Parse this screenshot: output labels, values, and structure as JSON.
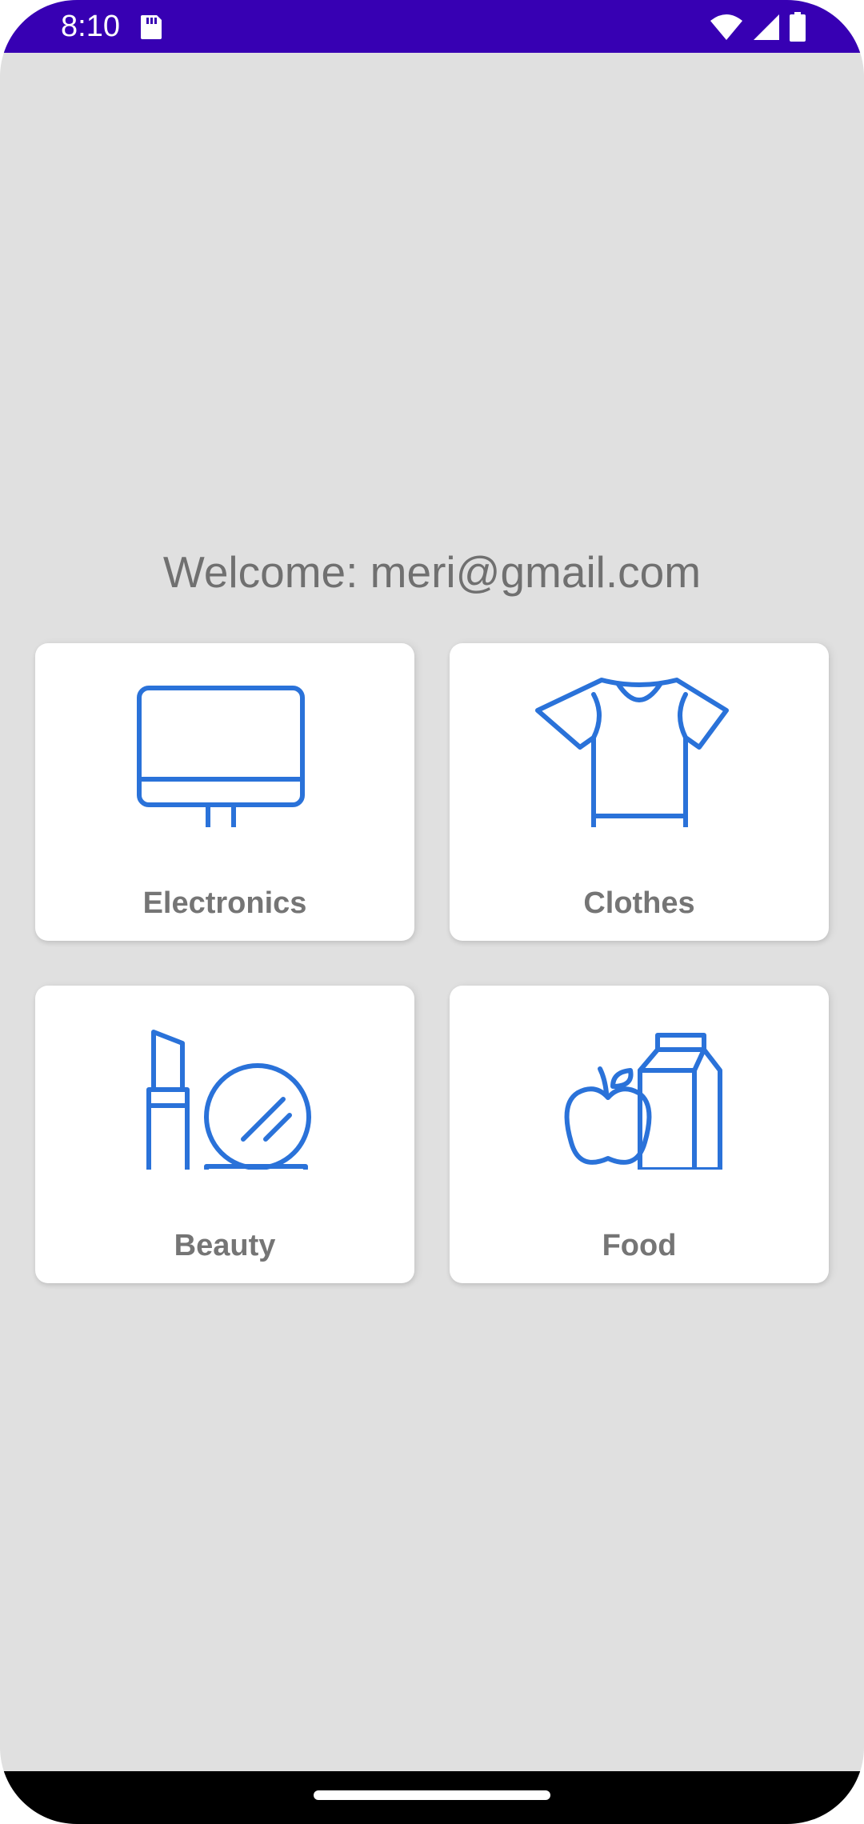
{
  "status_bar": {
    "time": "8:10",
    "background": "#3700b3",
    "icons": [
      "sd-card-icon",
      "wifi-icon",
      "signal-icon",
      "battery-icon"
    ]
  },
  "welcome_text": "Welcome: meri@gmail.com",
  "colors": {
    "icon_blue": "#2a72d9",
    "label_gray": "#757575",
    "background": "#e0e0e0"
  },
  "categories": [
    {
      "label": "Electronics",
      "icon": "monitor-icon"
    },
    {
      "label": "Clothes",
      "icon": "tshirt-icon"
    },
    {
      "label": "Beauty",
      "icon": "lipstick-mirror-icon"
    },
    {
      "label": "Food",
      "icon": "apple-milk-icon"
    }
  ]
}
